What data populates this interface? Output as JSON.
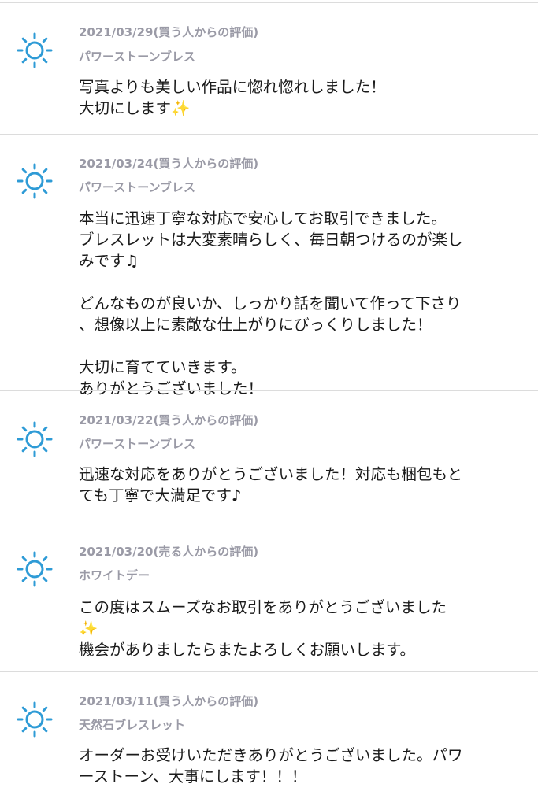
{
  "reviews": [
    {
      "date": "2021/03/29(買う人からの評価)",
      "product": "パワーストーンブレス",
      "comment": "写真よりも美しい作品に惚れ惚れしました！\n大切にします✨"
    },
    {
      "date": "2021/03/24(買う人からの評価)",
      "product": "パワーストーンブレス",
      "comment": "本当に迅速丁寧な対応で安心してお取引できました。\nブレスレットは大変素晴らしく、毎日朝つけるのが楽し\nみです♫\n\nどんなものが良いか、しっかり話を聞いて作って下さり\n、想像以上に素敵な仕上がりにびっくりしました！\n\n大切に育てていきます。\nありがとうございました！"
    },
    {
      "date": "2021/03/22(買う人からの評価)",
      "product": "パワーストーンブレス",
      "comment": "迅速な対応をありがとうございました！対応も梱包もと\nても丁寧で大満足です♪"
    },
    {
      "date": "2021/03/20(売る人からの評価)",
      "product": "ホワイトデー",
      "comment": "この度はスムーズなお取引をありがとうございました\n✨\n機会がありましたらまたよろしくお願いします。"
    },
    {
      "date": "2021/03/11(買う人からの評価)",
      "product": "天然石ブレスレット",
      "comment": "オーダーお受けいただきありがとうございました。パワ\nーストーン、大事にします！！！"
    }
  ],
  "icon": {
    "name": "sun-icon",
    "color": "#2e9bd6"
  }
}
